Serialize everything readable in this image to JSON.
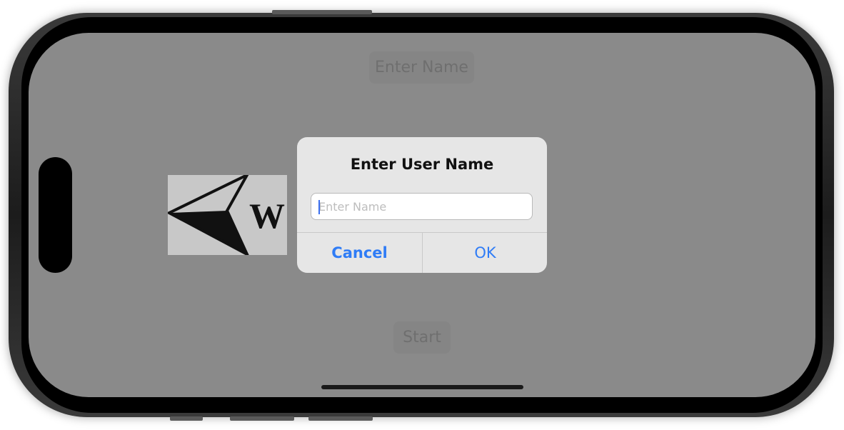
{
  "app": {
    "top_button_label": "Enter Name",
    "start_button_label": "Start",
    "logo_letter": "W"
  },
  "alert": {
    "title": "Enter User Name",
    "input_placeholder": "Enter Name",
    "input_value": "",
    "cancel_label": "Cancel",
    "ok_label": "OK"
  },
  "icons": {
    "logo": "navigation-arrow-icon"
  },
  "colors": {
    "accent": "#2f7cf6",
    "dim_background": "#8a8a8a",
    "alert_background": "#e6e6e6"
  }
}
